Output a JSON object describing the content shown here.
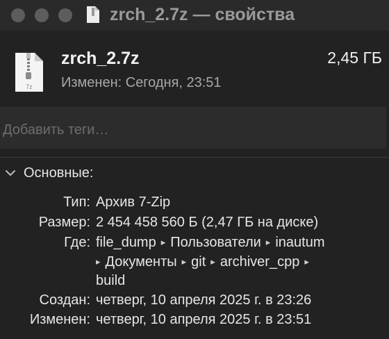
{
  "window": {
    "title": "zrch_2.7z — свойства"
  },
  "file": {
    "name": "zrch_2.7z",
    "size": "2,45 ГБ",
    "modified": "Изменен: Сегодня, 23:51",
    "icon_ext": "7z"
  },
  "tags": {
    "placeholder": "Добавить теги…"
  },
  "general": {
    "title": "Основные:",
    "type_label": "Тип:",
    "type_value": "Архив 7-Zip",
    "size_label": "Размер:",
    "size_value": "2 454 458 560 Б (2,47 ГБ на диске)",
    "where_label": "Где:",
    "path": [
      "file_dump",
      "Пользователи",
      "inautum",
      "Документы",
      "git",
      "archiver_cpp",
      "build"
    ],
    "path_separator": "▸",
    "created_label": "Создан:",
    "created_value": "четверг, 10 апреля 2025 г. в 23:26",
    "modified_label": "Изменен:",
    "modified_value": "четверг, 10 апреля 2025 г. в 23:51"
  },
  "icons": {
    "traffic_lights": [
      "close-button",
      "minimize-button",
      "zoom-button"
    ],
    "title_icon": "document-icon",
    "file_icon": "archive-file-icon",
    "section_toggle": "chevron-down-icon"
  },
  "colors": {
    "background": "#222222",
    "titlebar": "#2a2a2a",
    "traffic_light": "#5d5d5d",
    "text_primary": "#f2f2f2",
    "text_secondary": "#a8a8a8",
    "tags_field": "#2c2c2c"
  }
}
